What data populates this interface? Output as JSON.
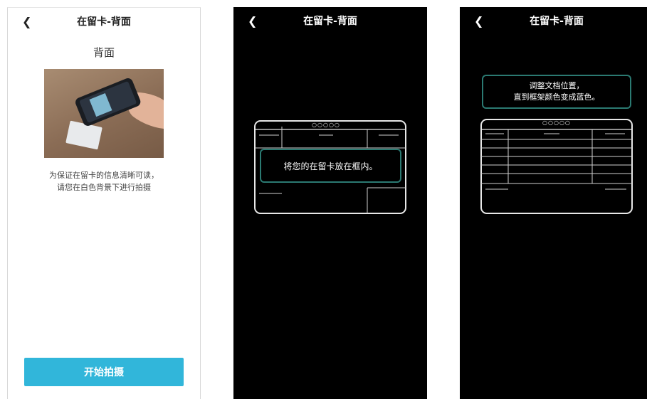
{
  "screen1": {
    "back_icon": "chevron-left-icon",
    "title": "在留卡-背面",
    "subtitle": "背面",
    "description_line1": "为保证在留卡的信息清晰可读，",
    "description_line2": "请您在白色背景下进行拍摄",
    "start_button": "开始拍摄",
    "button_color": "#31b6da"
  },
  "screen2": {
    "back_icon": "chevron-left-icon",
    "title": "在留卡-背面",
    "guide_message": "将您的在留卡放在框内。",
    "frame_label": "○○○○○",
    "accent": "#2b7a72"
  },
  "screen3": {
    "back_icon": "chevron-left-icon",
    "title": "在留卡-背面",
    "guide_line1": "调整文档位置，",
    "guide_line2": "直到框架颜色变成蓝色。",
    "frame_label": "○○○○○",
    "accent": "#2b7a72"
  }
}
